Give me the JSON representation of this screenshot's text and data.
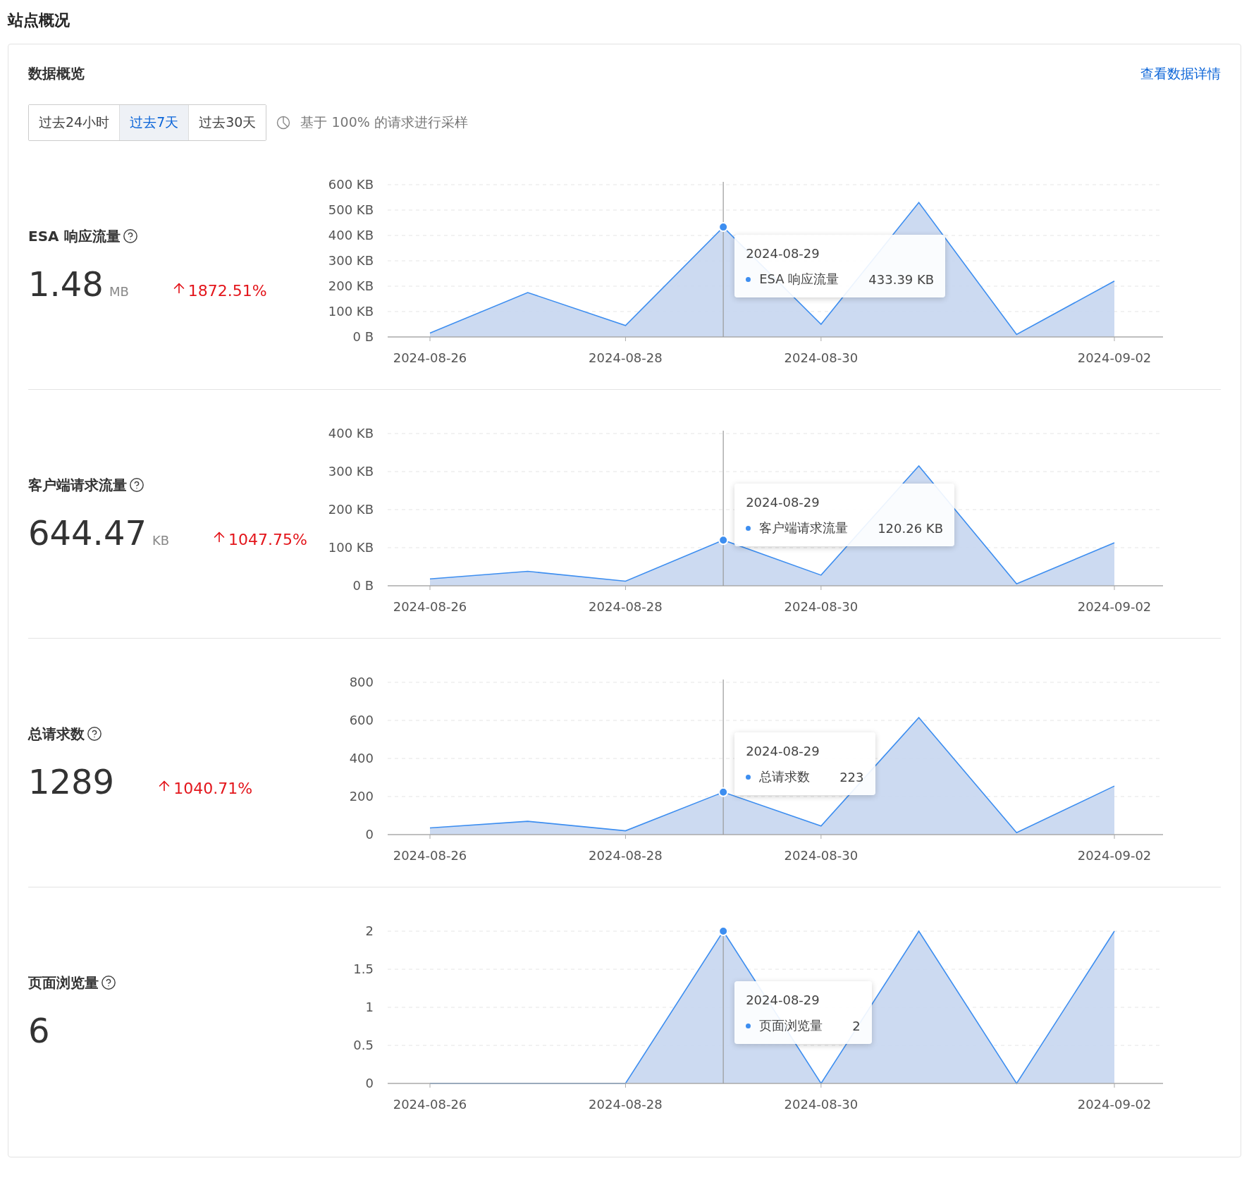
{
  "page_title": "站点概况",
  "card": {
    "title": "数据概览",
    "link": "查看数据详情",
    "ranges": [
      {
        "label": "过去24小时",
        "selected": false
      },
      {
        "label": "过去7天",
        "selected": true
      },
      {
        "label": "过去30天",
        "selected": false
      }
    ],
    "sampling_note": "基于 100% 的请求进行采样"
  },
  "metrics": [
    {
      "name": "ESA 响应流量",
      "value": "1.48",
      "unit": "MB",
      "change": "1872.51%",
      "increase": true,
      "tooltip": {
        "date": "2024-08-29",
        "value": "433.39 KB"
      },
      "chart_data": {
        "type": "area",
        "categories": [
          "2024-08-26",
          null,
          "2024-08-28",
          null,
          "2024-08-30",
          null,
          null,
          "2024-09-02"
        ],
        "series": [
          {
            "name": "ESA 响应流量",
            "color": "#3d8ef0",
            "values": [
              15,
              175,
              45,
              433,
              50,
              530,
              10,
              220
            ]
          }
        ],
        "ylim": [
          0,
          600
        ],
        "yticks": [
          {
            "value": 0,
            "label": "0 B"
          },
          {
            "value": 100,
            "label": "100 KB"
          },
          {
            "value": 200,
            "label": "200 KB"
          },
          {
            "value": 300,
            "label": "300 KB"
          },
          {
            "value": 400,
            "label": "400 KB"
          },
          {
            "value": 500,
            "label": "500 KB"
          },
          {
            "value": 600,
            "label": "600 KB"
          }
        ],
        "grid": true
      }
    },
    {
      "name": "客户端请求流量",
      "value": "644.47",
      "unit": "KB",
      "change": "1047.75%",
      "increase": true,
      "tooltip": {
        "date": "2024-08-29",
        "value": "120.26 KB"
      },
      "chart_data": {
        "type": "area",
        "categories": [
          "2024-08-26",
          null,
          "2024-08-28",
          null,
          "2024-08-30",
          null,
          null,
          "2024-09-02"
        ],
        "series": [
          {
            "name": "客户端请求流量",
            "color": "#3d8ef0",
            "values": [
              18,
              38,
              12,
              120,
              28,
              315,
              5,
              113
            ]
          }
        ],
        "ylim": [
          0,
          400
        ],
        "yticks": [
          {
            "value": 0,
            "label": "0 B"
          },
          {
            "value": 100,
            "label": "100 KB"
          },
          {
            "value": 200,
            "label": "200 KB"
          },
          {
            "value": 300,
            "label": "300 KB"
          },
          {
            "value": 400,
            "label": "400 KB"
          }
        ],
        "grid": true
      }
    },
    {
      "name": "总请求数",
      "value": "1289",
      "change": "1040.71%",
      "increase": true,
      "tooltip": {
        "date": "2024-08-29",
        "value": "223"
      },
      "chart_data": {
        "type": "area",
        "categories": [
          "2024-08-26",
          null,
          "2024-08-28",
          null,
          "2024-08-30",
          null,
          null,
          "2024-09-02"
        ],
        "series": [
          {
            "name": "总请求数",
            "color": "#3d8ef0",
            "values": [
              35,
              70,
              20,
              223,
              45,
              615,
              10,
              255
            ]
          }
        ],
        "ylim": [
          0,
          800
        ],
        "yticks": [
          0,
          200,
          400,
          600,
          800
        ],
        "grid": true
      }
    },
    {
      "name": "页面浏览量",
      "value": "6",
      "tooltip": {
        "date": "2024-08-29",
        "value": "2"
      },
      "chart_data": {
        "type": "area",
        "categories": [
          "2024-08-26",
          null,
          "2024-08-28",
          null,
          "2024-08-30",
          null,
          null,
          "2024-09-02"
        ],
        "series": [
          {
            "name": "页面浏览量",
            "color": "#3d8ef0",
            "values": [
              0,
              0,
              0,
              2,
              0,
              2,
              0,
              2
            ]
          }
        ],
        "ylim": [
          0,
          2
        ],
        "yticks": [
          0,
          0.5,
          1,
          1.5,
          2
        ],
        "grid": true
      }
    }
  ]
}
